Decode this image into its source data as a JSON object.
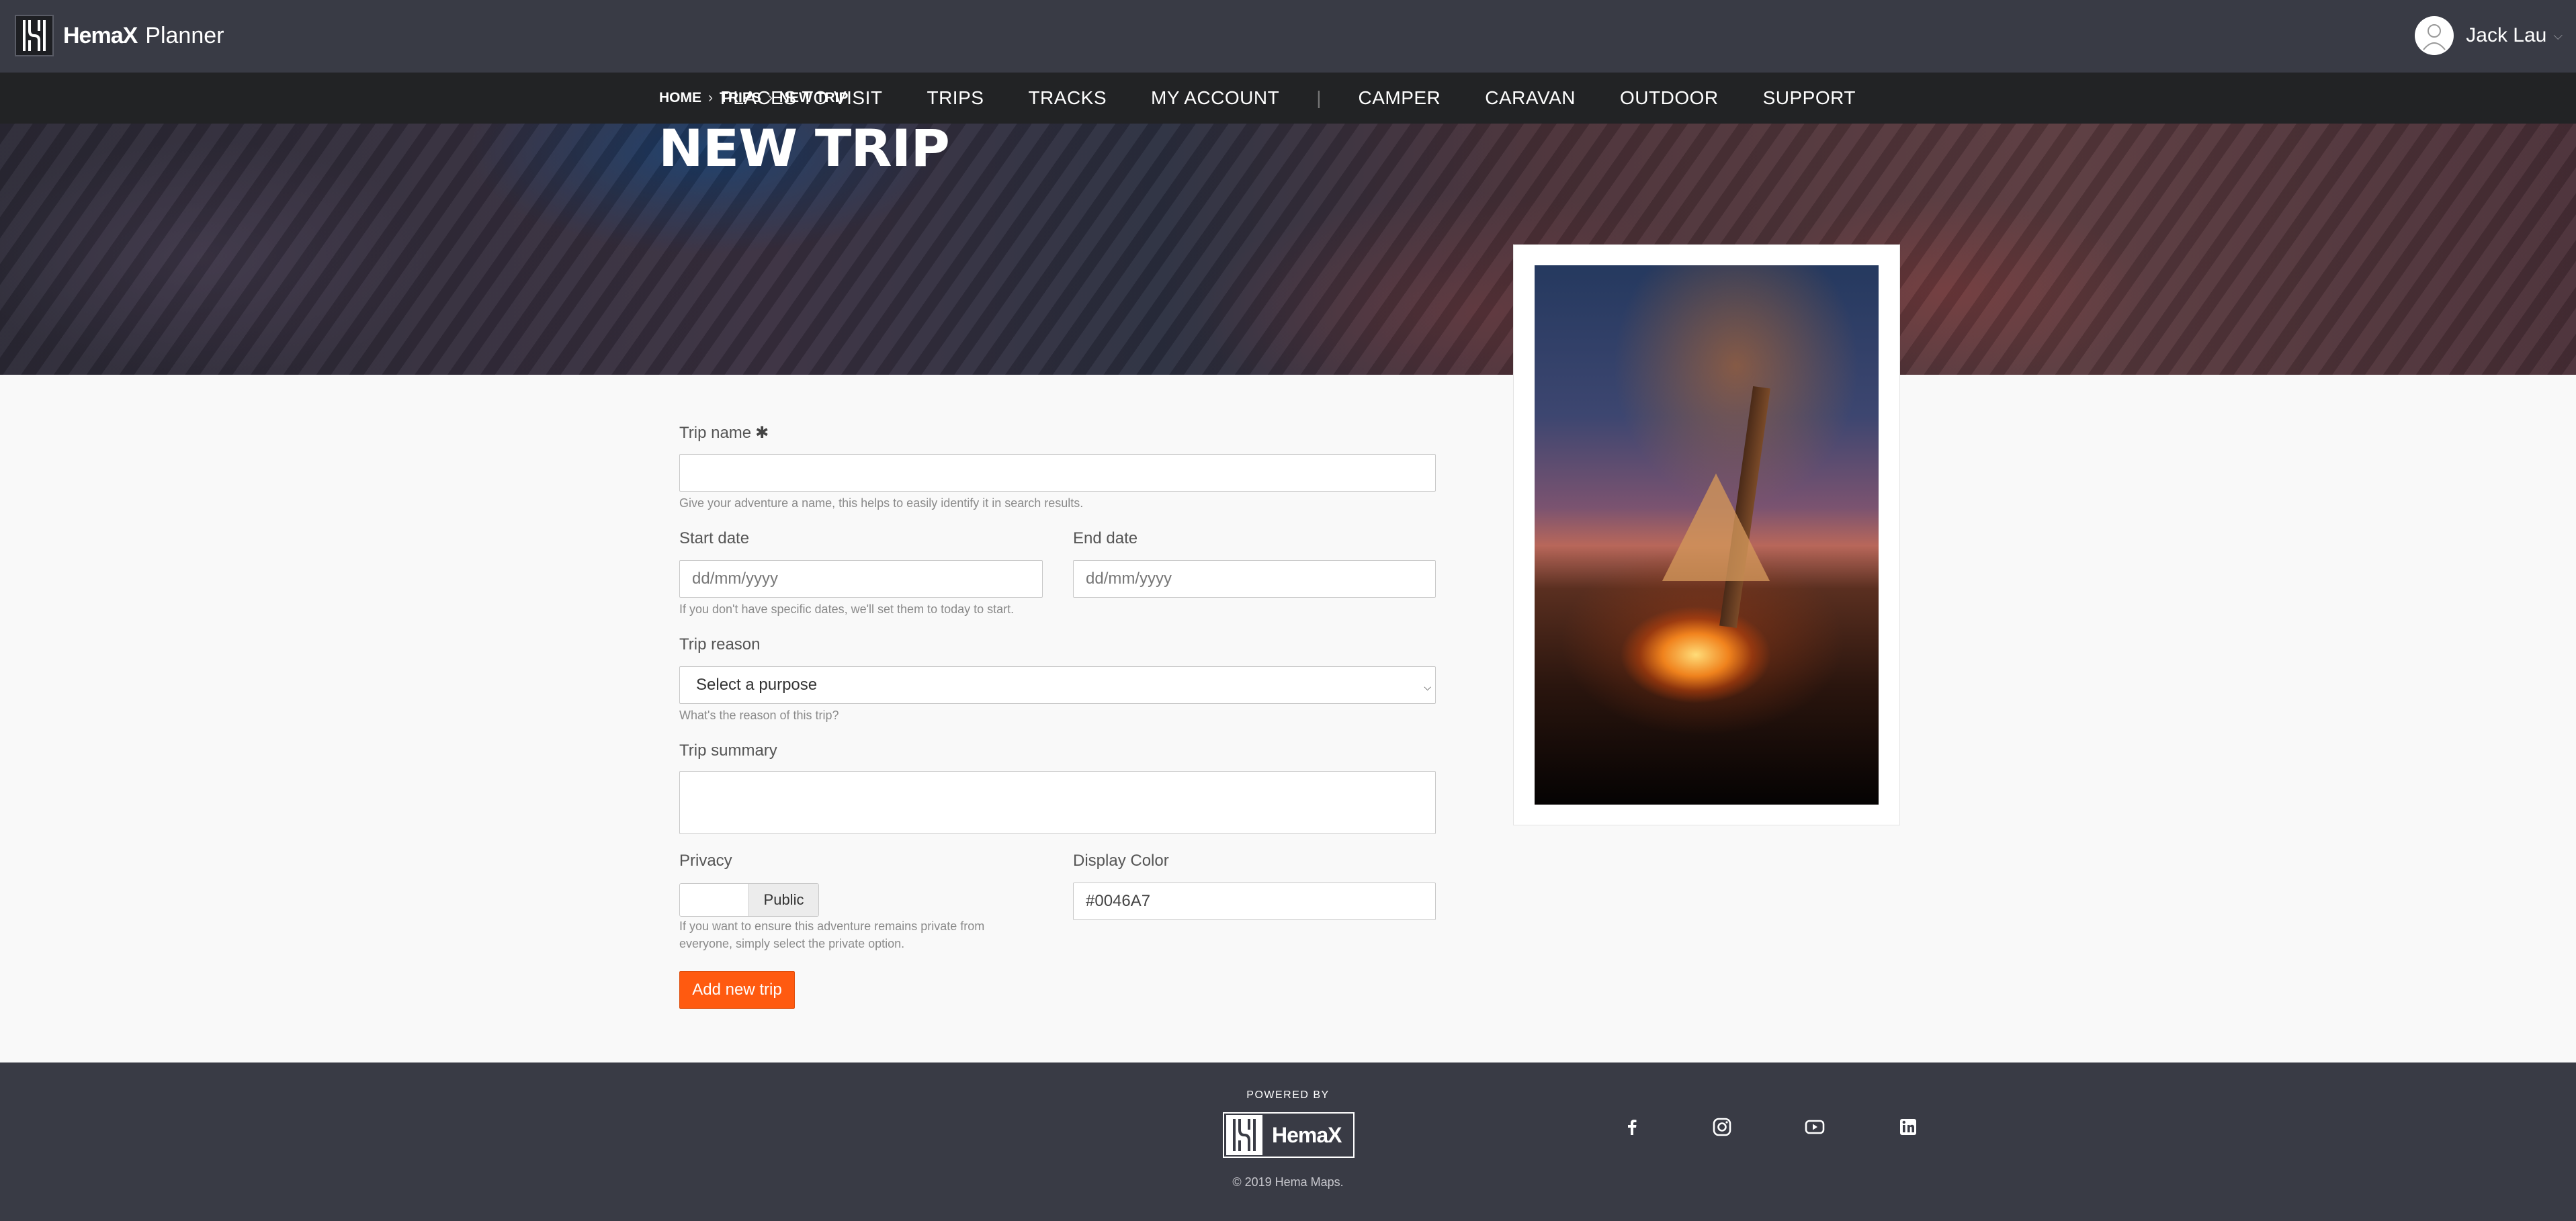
{
  "header": {
    "brand_bold": "HemaX",
    "brand_light": "Planner",
    "user_name": "Jack Lau"
  },
  "nav": {
    "items": [
      "PLACES TO VISIT",
      "TRIPS",
      "TRACKS",
      "MY ACCOUNT",
      "CAMPER",
      "CARAVAN",
      "OUTDOOR",
      "SUPPORT"
    ],
    "separator": "|"
  },
  "hero": {
    "breadcrumb": [
      "HOME",
      "TRIPS",
      "NEW TRIP"
    ],
    "breadcrumb_sep": "›",
    "title": "NEW TRIP"
  },
  "form": {
    "trip_name": {
      "label": "Trip name",
      "required_mark": "✱",
      "value": "",
      "help": "Give your adventure a name, this helps to easily identify it in search results."
    },
    "start_date": {
      "label": "Start date",
      "placeholder": "dd/mm/yyyy"
    },
    "end_date": {
      "label": "End date",
      "placeholder": "dd/mm/yyyy"
    },
    "date_help": "If you don't have specific dates, we'll set them to today to start.",
    "trip_reason": {
      "label": "Trip reason",
      "selected": "Select a purpose",
      "help": "What's the reason of this trip?"
    },
    "trip_summary": {
      "label": "Trip summary",
      "value": ""
    },
    "privacy": {
      "label": "Privacy",
      "state": "Public",
      "help_line1": "If you want to ensure this adventure remains private from",
      "help_line2": "everyone, simply select the private option."
    },
    "display_color": {
      "label": "Display Color",
      "value": "#0046A7"
    },
    "submit_label": "Add new trip"
  },
  "footer": {
    "powered_by": "POWERED BY",
    "logo_text": "HemaX",
    "copyright": "© 2019 Hema Maps.",
    "social": [
      "facebook-icon",
      "instagram-icon",
      "youtube-icon",
      "linkedin-icon"
    ]
  },
  "colors": {
    "topbar": "#393b45",
    "nav": "#222325",
    "accent": "#ff5a10",
    "page_bg": "#f9f9f9"
  }
}
